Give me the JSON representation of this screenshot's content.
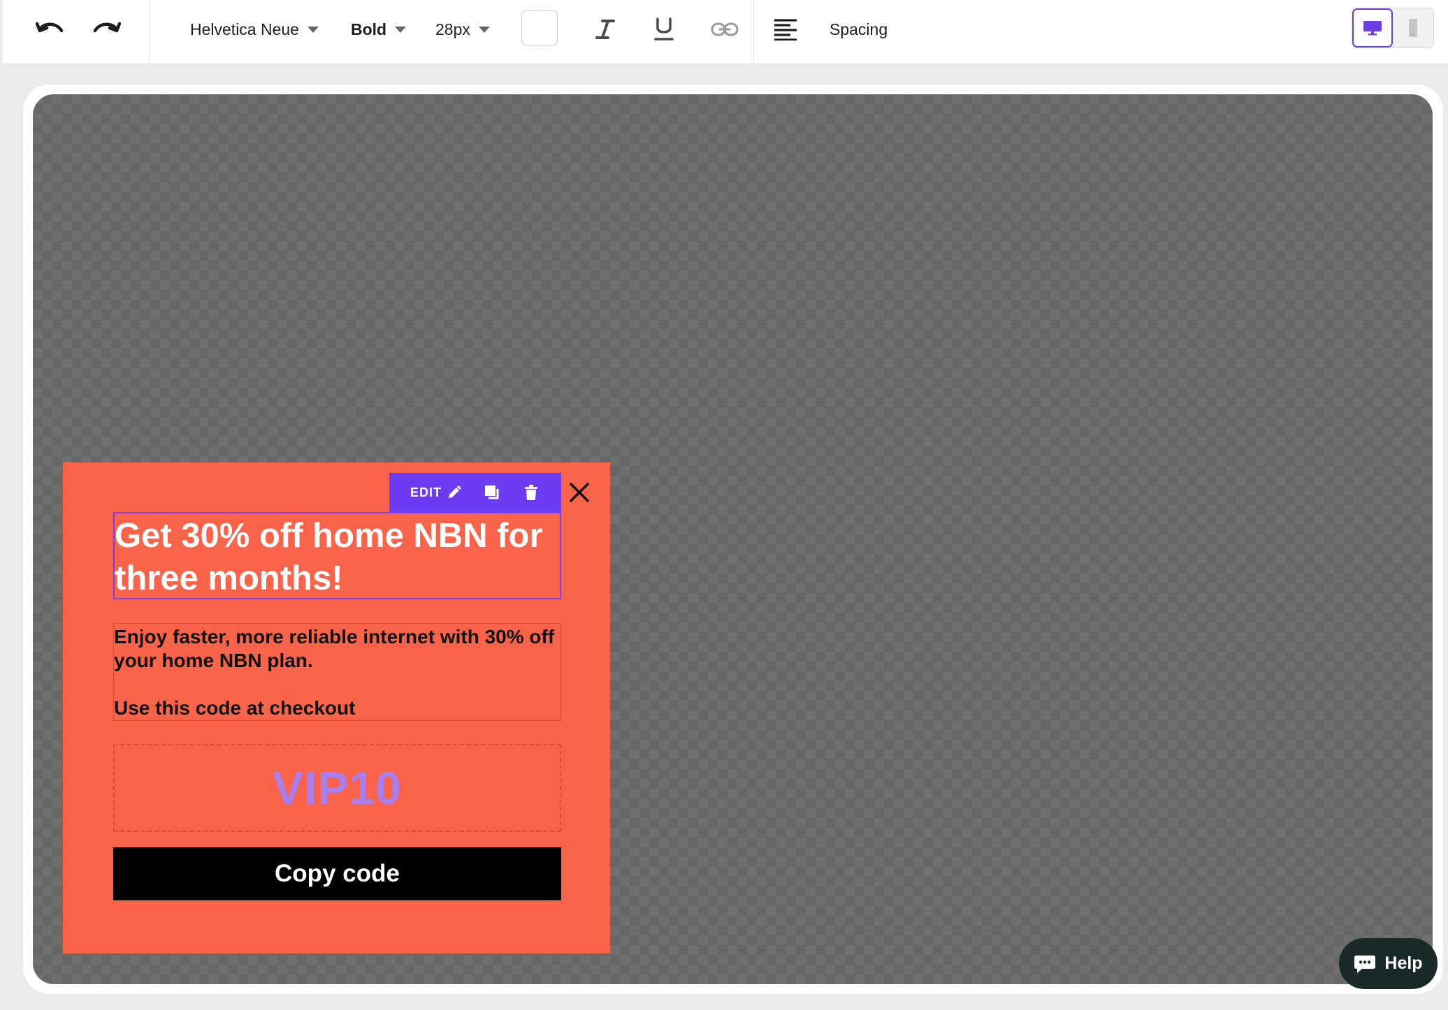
{
  "toolbar": {
    "font_family": "Helvetica Neue",
    "font_weight": "Bold",
    "font_size": "28px",
    "text_color": "#ffffff",
    "spacing_label": "Spacing",
    "active_device": "desktop",
    "accent_color": "#6c3cf2"
  },
  "popup": {
    "background_color": "#f8634a",
    "edit_toolbar": {
      "edit_label": "EDIT"
    },
    "headline": "Get 30% off home NBN for three months!",
    "body_line1": "Enjoy faster, more reliable internet with 30% off your home NBN plan.",
    "body_line2": "Use this code at checkout",
    "coupon_code": "VIP10",
    "copy_button_label": "Copy code"
  },
  "help": {
    "label": "Help"
  }
}
